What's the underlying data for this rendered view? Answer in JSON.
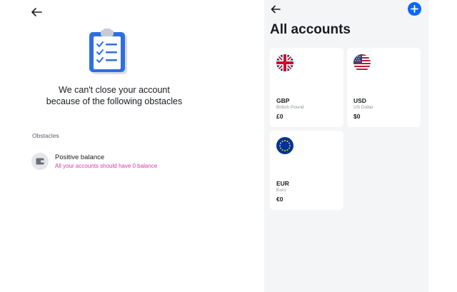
{
  "close_account": {
    "headline_line1": "We can't close your account",
    "headline_line2": "because of the following obstacles",
    "obstacles_title": "Obstacles",
    "obstacles": [
      {
        "name": "Positive balance",
        "description": "All your accounts should have 0 balance"
      }
    ]
  },
  "accounts": {
    "title": "All accounts",
    "items": [
      {
        "code": "GBP",
        "name": "British Pound",
        "balance": "£0",
        "flag": "uk-flag-icon"
      },
      {
        "code": "USD",
        "name": "US Dollar",
        "balance": "$0",
        "flag": "us-flag-icon"
      },
      {
        "code": "EUR",
        "name": "Euro",
        "balance": "€0",
        "flag": "eu-flag-icon"
      }
    ]
  },
  "colors": {
    "accent": "#0a66ff",
    "warning_text": "#d63aa6",
    "panel_bg": "#f4f5f7",
    "clipboard": "#2e6fe0"
  }
}
